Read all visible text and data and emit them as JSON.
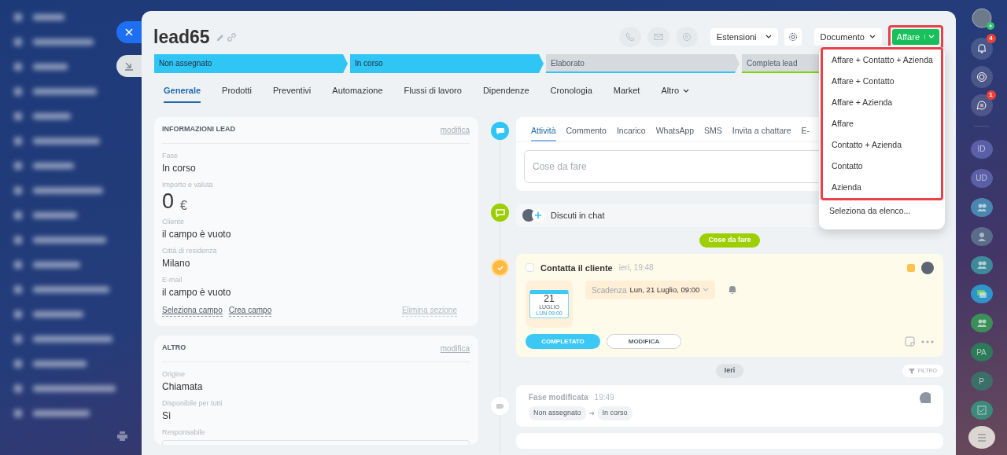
{
  "header": {
    "title": "lead65",
    "extensions": "Estensioni",
    "document": "Documento",
    "convert": {
      "label": "Affare",
      "highlighted": true
    }
  },
  "stages": [
    {
      "label": "Non assegnato",
      "reached": true,
      "color": "#2fc6f6"
    },
    {
      "label": "In corso",
      "reached": true,
      "color": "#2fc6f6"
    },
    {
      "label": "Elaborato",
      "reached": false,
      "color": "#2fc6f6"
    },
    {
      "label": "Completa lead",
      "reached": false,
      "color": "#7bd500"
    }
  ],
  "tabs": [
    {
      "label": "Generale",
      "selected": true,
      "kind": "link"
    },
    {
      "label": "Prodotti",
      "selected": false,
      "kind": "link"
    },
    {
      "label": "Preventivi",
      "selected": false,
      "kind": "link"
    },
    {
      "label": "Automazione",
      "selected": false,
      "kind": "link"
    },
    {
      "label": "Flussi di lavoro",
      "selected": false,
      "kind": "link"
    },
    {
      "label": "Dipendenze",
      "selected": false,
      "kind": "link"
    },
    {
      "label": "Cronologia",
      "selected": false,
      "kind": "link"
    },
    {
      "label": "Market",
      "selected": false,
      "kind": "link"
    },
    {
      "label": "Altro",
      "selected": false,
      "kind": "menu"
    }
  ],
  "cards": [
    {
      "title": "INFORMAZIONI LEAD",
      "action": "modifica",
      "fields": [
        {
          "kind": "text",
          "label": "Fase",
          "value": "In corso"
        },
        {
          "kind": "amount",
          "label": "Importo e valuta",
          "value": "0",
          "currency": "€"
        },
        {
          "kind": "text",
          "label": "Cliente",
          "value": "il campo è vuoto"
        },
        {
          "kind": "text",
          "label": "Città di residenza",
          "value": "Milano"
        },
        {
          "kind": "text",
          "label": "E-mail",
          "value": "il campo è vuoto"
        }
      ],
      "links": [
        "Seleziona campo",
        "Crea campo"
      ],
      "remove": "Elimina sezione"
    },
    {
      "title": "ALTRO",
      "action": "modifica",
      "fields": [
        {
          "kind": "text",
          "label": "Origine",
          "value": "Chiamata"
        },
        {
          "kind": "text",
          "label": "Disponibile per tutti",
          "value": "Sì"
        },
        {
          "kind": "user",
          "label": "Responsabile"
        }
      ]
    }
  ],
  "composer": {
    "tabs": [
      {
        "label": "Attività",
        "selected": true
      },
      {
        "label": "Commento",
        "selected": false
      },
      {
        "label": "Incarico",
        "selected": false
      },
      {
        "label": "WhatsApp",
        "selected": false
      },
      {
        "label": "SMS",
        "selected": false
      },
      {
        "label": "Invita a chattare",
        "selected": false
      },
      {
        "label": "E-",
        "selected": false
      }
    ],
    "placeholder": "Cose da fare"
  },
  "chat": {
    "label": "Discuti in chat"
  },
  "todo_divider": "Cose da fare",
  "task": {
    "title": "Contatta il cliente",
    "time": "ieri, 19:48",
    "done": false,
    "day": "21",
    "month": "LUGLIO",
    "weekday": "LUN 09:00",
    "deadline_label": "Scadenza",
    "deadline": "Lun, 21 Luglio, 09:00",
    "complete": "COMPLETATO",
    "edit": "MODIFICA"
  },
  "history_divider": "Ieri",
  "filter": "FILTRO",
  "event": {
    "title": "Fase modificata",
    "time": "19:49",
    "from": "Non assegnato",
    "to": "In corso"
  },
  "dropdown": {
    "items": [
      {
        "label": "Affare + Contatto + Azienda",
        "highlighted": true
      },
      {
        "label": "Affare + Contatto",
        "highlighted": true
      },
      {
        "label": "Affare + Azienda",
        "highlighted": true
      },
      {
        "label": "Affare",
        "highlighted": true
      },
      {
        "label": "Contatto + Azienda",
        "highlighted": true
      },
      {
        "label": "Contatto",
        "highlighted": true
      },
      {
        "label": "Azienda",
        "highlighted": true
      },
      {
        "label": "Seleziona da elenco...",
        "highlighted": false
      }
    ]
  },
  "right_bar": {
    "notifications": "4",
    "chats": "1",
    "contacts": [
      {
        "kind": "initials",
        "text": "ID",
        "color": "#5b5fa8"
      },
      {
        "kind": "initials",
        "text": "UD",
        "color": "#5b5fa8"
      },
      {
        "kind": "group",
        "color": "#4a87b0"
      },
      {
        "kind": "photo",
        "color": "#5a6c8a"
      },
      {
        "kind": "group",
        "color": "#3f8a9a"
      },
      {
        "kind": "chat",
        "color": "#2f95c8"
      },
      {
        "kind": "group",
        "color": "#3d8f5a"
      },
      {
        "kind": "initials",
        "text": "PA",
        "color": "#2d7a5a"
      },
      {
        "kind": "initials",
        "text": "P",
        "color": "#3d6f6a"
      },
      {
        "kind": "task",
        "color": "#3d8a7a"
      }
    ]
  }
}
